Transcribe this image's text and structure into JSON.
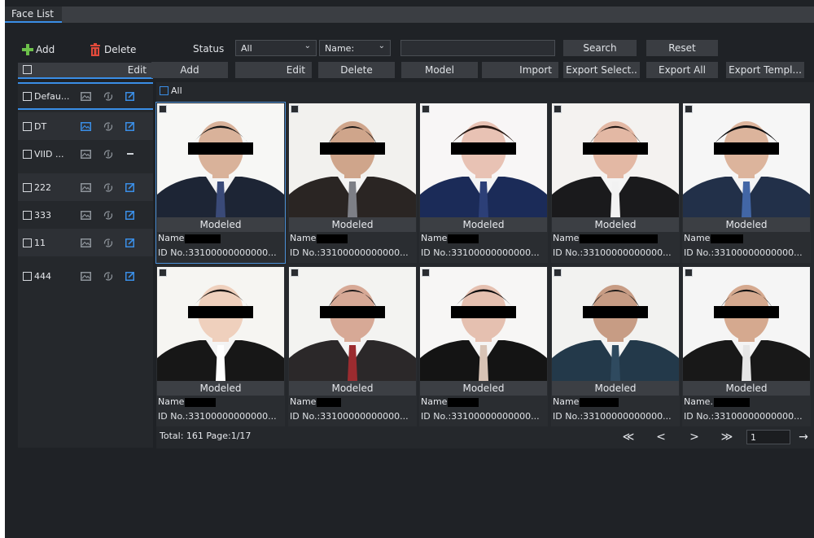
{
  "tab": {
    "label": "Face List"
  },
  "toolbar": {
    "add_label": "Add",
    "delete_label": "Delete",
    "status_label": "Status",
    "status_value": "All",
    "name_field_value": "Name:",
    "search_value": "",
    "search_label": "Search",
    "reset_label": "Reset"
  },
  "list_header": {
    "edit_label": "Edit"
  },
  "actions": {
    "add": "Add",
    "edit": "Edit",
    "delete": "Delete",
    "model": "Model",
    "import": "Import",
    "export_selected": "Export Select..",
    "export_all": "Export All",
    "export_template": "Export Templ..."
  },
  "select_all_label": "All",
  "libraries": [
    {
      "label": "Defau...",
      "edit": true
    },
    {
      "label": "DT",
      "edit": true
    },
    {
      "label": "VIID ...",
      "edit": false
    },
    {
      "label": "222",
      "edit": true
    },
    {
      "label": "333",
      "edit": true
    },
    {
      "label": "11",
      "edit": true
    },
    {
      "label": "444",
      "edit": true
    }
  ],
  "faces": [
    {
      "status": "Modeled",
      "name_label": "Name",
      "id": "ID No.:33100000000000..."
    },
    {
      "status": "Modeled",
      "name_label": "Name",
      "id": "ID No.:33100000000000..."
    },
    {
      "status": "Modeled",
      "name_label": "Name",
      "id": "ID No.:33100000000000..."
    },
    {
      "status": "Modeled",
      "name_label": "Name",
      "id": "ID No.:33100000000000..."
    },
    {
      "status": "Modeled",
      "name_label": "Name",
      "id": "ID No.:33100000000000..."
    },
    {
      "status": "Modeled",
      "name_label": "Name",
      "id": "ID No.:33100000000000..."
    },
    {
      "status": "Modeled",
      "name_label": "Name",
      "id": "ID No.:33100000000000..."
    },
    {
      "status": "Modeled",
      "name_label": "Name",
      "id": "ID No.:33100000000000..."
    },
    {
      "status": "Modeled",
      "name_label": "Name",
      "id": "ID No.:33100000000000..."
    },
    {
      "status": "Modeled",
      "name_label": "Name.",
      "id": "ID No.:33100000000000..."
    }
  ],
  "footer": {
    "summary": "Total: 161  Page:1/17",
    "page_input": "1"
  },
  "pager": {
    "first": "≪",
    "prev": "<",
    "next": ">",
    "last": "≫",
    "go": "→"
  },
  "colors": {
    "accent": "#3a8ee6",
    "add_icon": "#6cc04a",
    "delete_icon": "#e24a3b",
    "background": "#1f2226"
  }
}
